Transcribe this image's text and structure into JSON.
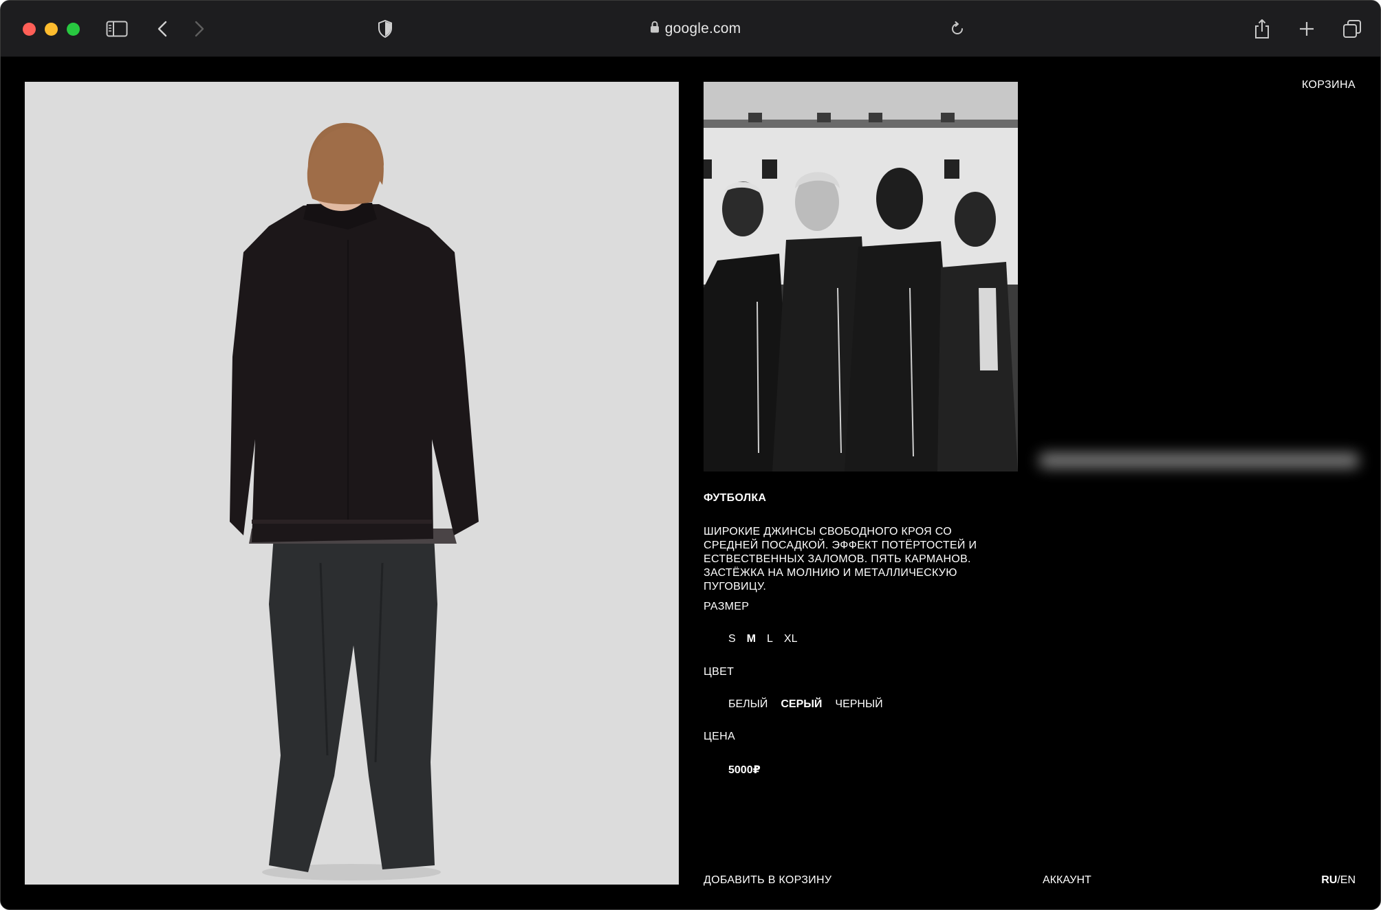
{
  "browser": {
    "address": "google.com",
    "icons": [
      "sidebar-icon",
      "back-icon",
      "forward-icon",
      "shield-icon",
      "lock-icon",
      "reload-icon",
      "share-icon",
      "new-tab-icon",
      "tabs-icon"
    ]
  },
  "header": {
    "cart_label": "КОРЗИНА"
  },
  "product": {
    "title": "ФУТБОЛКА",
    "description": "ШИРОКИЕ ДЖИНСЫ СВОБОДНОГО КРОЯ СО СРЕДНЕЙ ПОСАДКОЙ. ЭФФЕКТ ПОТЁРТОСТЕЙ И ЕСТВЕСТВЕННЫХ ЗАЛОМОВ. ПЯТЬ КАРМАНОВ. ЗАСТЁЖКА НА МОЛНИЮ И МЕТАЛЛИЧЕСКУЮ ПУГОВИЦУ.",
    "size_label": "РАЗМЕР",
    "sizes": [
      {
        "label": "S",
        "selected": false
      },
      {
        "label": "M",
        "selected": true
      },
      {
        "label": "L",
        "selected": false
      },
      {
        "label": "XL",
        "selected": false
      }
    ],
    "color_label": "ЦВЕТ",
    "colors": [
      {
        "label": "БЕЛЫЙ",
        "selected": false
      },
      {
        "label": "СЕРЫЙ",
        "selected": true
      },
      {
        "label": "ЧЕРНЫЙ",
        "selected": false
      }
    ],
    "price_label": "ЦЕНА",
    "price": "5000₽"
  },
  "footer": {
    "add_to_cart": "ДОБАВИТЬ В КОРЗИНУ",
    "account": "АККАУНТ",
    "lang_active": "RU",
    "lang_separator": "/",
    "lang_other": "EN"
  },
  "colors": {
    "page_bg": "#000000",
    "toolbar_bg": "#1d1d1f",
    "text": "#ffffff",
    "photo_bg": "#dcdcdc"
  }
}
